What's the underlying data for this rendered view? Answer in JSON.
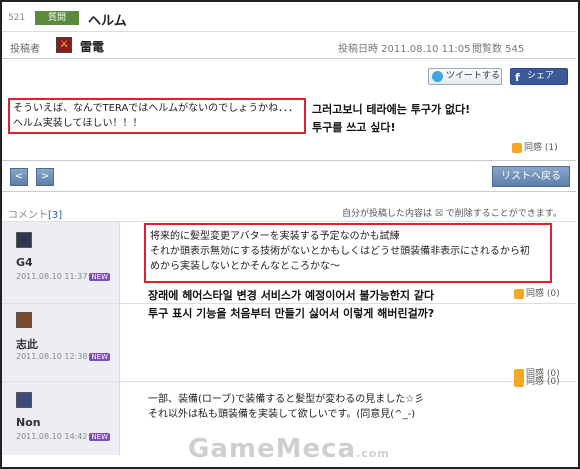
{
  "post": {
    "number": "521",
    "category": "質問",
    "title": "ヘルム",
    "author_label": "投稿者",
    "author_name": "雷電",
    "date": "投稿日時 2011.08.10 11:05",
    "views": "閲覧数 545",
    "body_line1": "そういえば、なんでTERAではヘルムがないのでしょうかね．．．",
    "body_line2": "ヘルム実装してほしい！！！",
    "like": "同感 (1)"
  },
  "share": {
    "tweet": "ツイートする",
    "facebook": "シェア"
  },
  "annotation1": {
    "line1": "그러고보니 테라에는 투구가 없다!",
    "line2": "투구를 쓰고 싶다!"
  },
  "nav": {
    "prev": "<",
    "next": ">",
    "back_to_list": "リストへ戻る"
  },
  "comments_header": {
    "label": "コメント",
    "count": "[3]",
    "note": "自分が投稿した内容は ☒ で削除することができます。"
  },
  "comments": [
    {
      "name": "G4",
      "date": "2011.08.10 11:37",
      "badge": "NEW",
      "line1": "将来的に髪型変更アバターを実装する予定なのかも試練",
      "line2": "それか頭表示無効にする技術がないとかもしくはどうせ頭装備非表示にされるから初",
      "line3": "めから実装しないとかそんなところかな～",
      "like": "同感 (0)"
    },
    {
      "name": "志此",
      "date": "2011.08.10 12:38",
      "badge": "NEW",
      "like": "同感 (0)"
    },
    {
      "name": "Non",
      "date": "2011.08.10 14:42",
      "badge": "NEW",
      "line1": "一部、装備(ローブ)で装備すると髪型が変わるの見ました☆彡",
      "line2": "それ以外は私も頭装備を実装して欲しいです。(同意見(^_-)",
      "like": "同感 (0)"
    }
  ],
  "annotation2": {
    "line1": "장래에 헤어스타일 변경 서비스가 예정이어서 불가능한지 같다",
    "line2": "투구 표시 기능을 처음부터 만들기 싫어서 이렇게 해버린걸까?"
  },
  "watermark": {
    "text": "GameMeca",
    "suffix": ".com"
  },
  "colors": {
    "highlight_box": "#e0202a",
    "nav_button": "#6b8bb5",
    "category_badge": "#5b8a3c",
    "new_badge": "#7e4bb8"
  }
}
